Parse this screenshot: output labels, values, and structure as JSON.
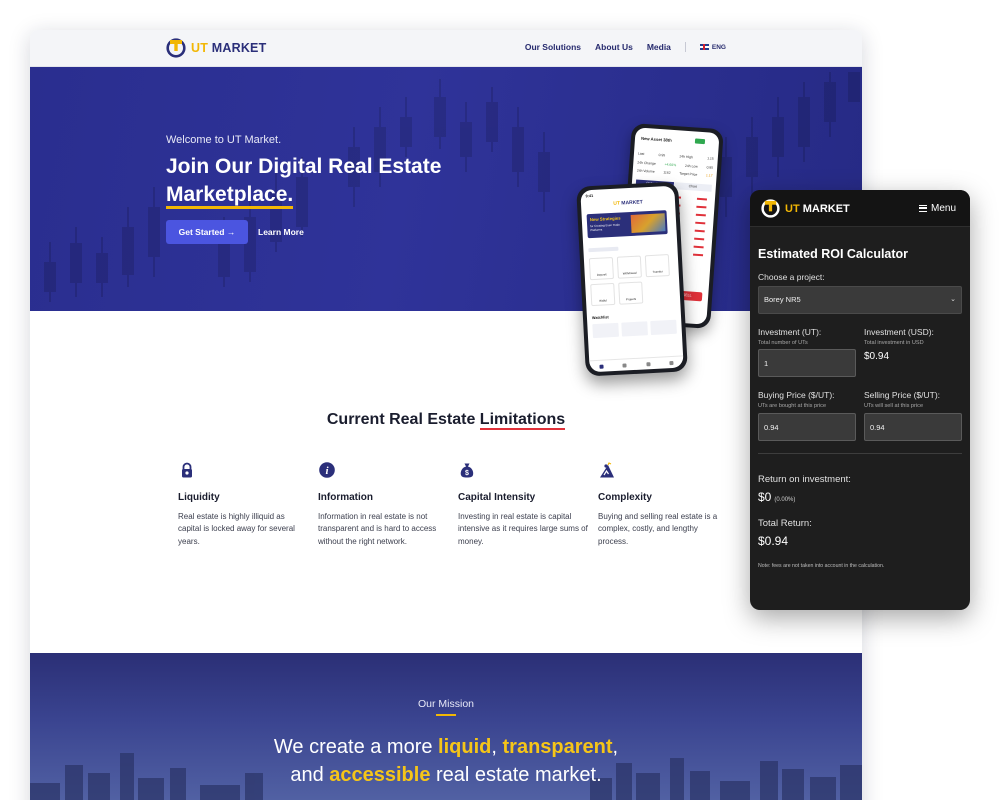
{
  "site": {
    "brand": {
      "name_prefix": "UT",
      "name_suffix": " MARKET"
    },
    "nav": {
      "items": [
        "Our Solutions",
        "About Us",
        "Media"
      ],
      "language": "ENG"
    },
    "hero": {
      "welcome": "Welcome to UT Market.",
      "title_line1": "Join Our Digital Real Estate",
      "title_line2": "Marketplace.",
      "cta_primary": "Get Started →",
      "cta_secondary": "Learn More"
    },
    "limitations": {
      "title_prefix": "Current Real Estate ",
      "title_emph": "Limitations",
      "items": [
        {
          "icon": "lock-icon",
          "title": "Liquidity",
          "text": "Real estate is highly illiquid as capital is locked away for several years."
        },
        {
          "icon": "info-icon",
          "title": "Information",
          "text": "Information in real estate is not transparent and is hard to access without the right network."
        },
        {
          "icon": "money-bag-icon",
          "title": "Capital Intensity",
          "text": "Investing in real estate is capital intensive as it requires large sums of money."
        },
        {
          "icon": "climber-icon",
          "title": "Complexity",
          "text": "Buying and selling real estate is a complex, costly, and lengthy process."
        }
      ]
    },
    "mission": {
      "kicker": "Our Mission",
      "l1_a": "We create a more ",
      "l1_b": "liquid",
      "l1_c": ", ",
      "l1_d": "transparent",
      "l1_e": ",",
      "l2_a": "and ",
      "l2_b": "accessible",
      "l2_c": " real estate market."
    }
  },
  "phones": {
    "back": {
      "header": "New Asset 38th",
      "stats": [
        [
          "Last",
          "0.95",
          "24h High",
          "1.15"
        ],
        [
          "24h Change",
          "+4.60%",
          "24h Low",
          "0.85"
        ],
        [
          "24h Volume",
          "1162",
          "Target Price",
          "1.17"
        ]
      ],
      "tabs": [
        "Order Book",
        "Chart"
      ],
      "buy": "BUY",
      "sell": "SELL"
    },
    "front": {
      "time": "9:41",
      "banner": "New Strategies",
      "banner_sub": "for Creating Even Trade Platforms",
      "tiles": [
        "Deposit",
        "Withdrawal",
        "Transfer",
        "Wallet",
        "Projects"
      ],
      "watchlist": "Watchlist"
    }
  },
  "calculator": {
    "brand": {
      "name_prefix": "UT",
      "name_suffix": " MARKET"
    },
    "menu": "Menu",
    "title": "Estimated ROI Calculator",
    "project_label": "Choose a project:",
    "project_value": "Borey NR5",
    "investment_ut_label": "Investment (UT):",
    "investment_ut_sub": "Total number of UTs",
    "investment_ut_value": "1",
    "investment_usd_label": "Investment (USD):",
    "investment_usd_sub": "Total investment in USD",
    "investment_usd_value": "$0.94",
    "buy_label": "Buying Price ($/UT):",
    "buy_sub": "UTs are bought at this price",
    "buy_value": "0.94",
    "sell_label": "Selling Price ($/UT):",
    "sell_sub": "UTs will sell at this price",
    "sell_value": "0.94",
    "roi_label": "Return on investment:",
    "roi_value": "$0",
    "roi_pct": "(0.00%)",
    "total_label": "Total Return:",
    "total_value": "$0.94",
    "note": "Note: fees are not taken into account in the calculation."
  },
  "colors": {
    "brand_navy": "#2b2f7a",
    "brand_yellow": "#f2b705",
    "hero_blue": "#2f3399",
    "cta_blue": "#4b55e0",
    "accent_red": "#e0313a"
  }
}
